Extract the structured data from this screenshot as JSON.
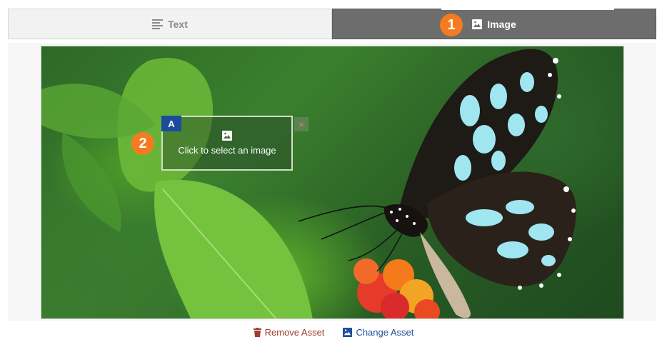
{
  "tabs": [
    {
      "label": "Text",
      "icon": "text-lines-icon",
      "active": false
    },
    {
      "label": "Image",
      "icon": "image-icon",
      "active": true
    }
  ],
  "badges": {
    "step1": "1",
    "step2": "2"
  },
  "slot": {
    "tag": "A",
    "prompt": "Click to select an image",
    "close": "×",
    "icon": "image-icon"
  },
  "actions": {
    "remove_label": "Remove Asset",
    "change_label": "Change Asset"
  },
  "colors": {
    "badge": "#f47b20",
    "active_tab": "#6d6d6d",
    "slot_tag": "#1b4c9c",
    "remove": "#a33a33",
    "change": "#1f4e9a"
  }
}
